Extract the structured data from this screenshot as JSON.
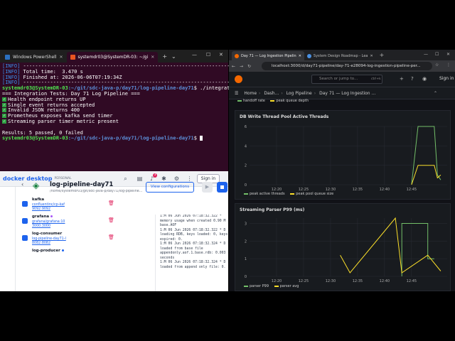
{
  "terminal": {
    "tabs": [
      "Windows PowerShell",
      "systemdr03@SystemDR-03: ~/gi"
    ],
    "output": [
      [
        "[INFO] ",
        "------------------------------------------------------------------------"
      ],
      [
        "[INFO] ",
        "Total time:  3.470 s"
      ],
      [
        "[INFO] ",
        "Finished at: 2026-06-06T07:19:34Z"
      ],
      [
        "[INFO] ",
        "------------------------------------------------------------------------"
      ]
    ],
    "prompt_user": "systemdr03@SystemDR-03",
    "prompt_path": ":~/git/sdc-java-p/day71/log-pipeline-day71",
    "command": "$ ./integration-tests/test-pipeline.sh",
    "header": "=== Integration Tests: Day 71 Log Pipeline ===",
    "checks": [
      "Health endpoint returns UP",
      "Single event returns accepted",
      "Invalid JSON returns 400",
      "Prometheus exposes kafka send timer",
      "Streaming parser timer metric present"
    ],
    "results": "Results: 5 passed, 0 failed",
    "prompt2_path": ":~/git/sdc-java-p/day71/log-pipeline-day71",
    "prompt2_suffix": "$ "
  },
  "docker": {
    "brand": "docker desktop",
    "plan": "PERSONAL",
    "notif_count": "3",
    "sign_in": "Sign in",
    "project_title": "log-pipeline-day71",
    "project_path": "/home/systemdr03/git/sdc-java-p/day71/log-pipeline...",
    "view_config": "View configurations",
    "containers": [
      {
        "name": "kafka",
        "image": "confluentinc/cp-kaf",
        "ports": "9092:9092"
      },
      {
        "name": "grafana",
        "image": "grafana/grafana:10",
        "ports": "3000:3000"
      },
      {
        "name": "log-consumer",
        "image": "log-pipeline-day71-l",
        "ports": "8082:8082"
      },
      {
        "name": "log-producer",
        "image": "",
        "ports": ""
      }
    ],
    "logs": [
      "1:M 06 Jun 2026 07:18:32.322 *",
      "memory usage when created 0.90 M",
      "base.AOF",
      "1:M 06 Jun 2026 07:18:32.322 * D",
      "loading RDB, keys loaded: 0, keys",
      "expired: 0.",
      "1:M 06 Jun 2026 07:18:32.324 * D",
      "loaded from base file",
      "appendonly.aof.1.base.rdb: 0.003",
      "seconds",
      "1:M 06 Jun 2026 07:18:32.324 * D",
      "loaded from append only file: 0."
    ]
  },
  "browser": {
    "tabs": [
      "Day 71 — Log Ingestion Pipelin",
      "System Design Roadmap - Lea"
    ],
    "url": "localhost:3000/d/day71-pipeline/day-71-e28094-log-ingestion-pipeline-per...",
    "search_placeholder": "Search or jump to...",
    "search_shortcut": "ctrl+k",
    "sign_in": "Sign in",
    "breadcrumb": [
      "Home",
      "Dash...",
      "Log Pipeline",
      "Day 71 — Log Ingestion ..."
    ],
    "colors": {
      "green": "#73bf69",
      "yellow": "#fade2a",
      "orange": "#f46800"
    }
  },
  "chart_data": [
    {
      "type": "line",
      "title": "",
      "legend": [
        "handoff rate",
        "peak queue depth"
      ],
      "series": []
    },
    {
      "type": "line",
      "title": "DB Write Thread Pool Active Threads",
      "x": [
        "12:20",
        "12:25",
        "12:30",
        "12:35",
        "12:40",
        "12:45"
      ],
      "ylim": [
        0,
        6
      ],
      "yticks": [
        "0",
        "2",
        "4",
        "6"
      ],
      "series": [
        {
          "name": "peak active threads",
          "color": "#73bf69",
          "points": [
            [
              12.75,
              0
            ],
            [
              12.77,
              6
            ],
            [
              12.82,
              6
            ],
            [
              12.83,
              1
            ],
            [
              12.84,
              0.5
            ]
          ]
        },
        {
          "name": "peak pool queue size",
          "color": "#fade2a",
          "points": [
            [
              12.75,
              0
            ],
            [
              12.77,
              2
            ],
            [
              12.82,
              2
            ],
            [
              12.83,
              0.7
            ],
            [
              12.84,
              1
            ]
          ]
        }
      ]
    },
    {
      "type": "line",
      "title": "Streaming Parser P99 (ms)",
      "x": [
        "12:20",
        "12:25",
        "12:30",
        "12:35",
        "12:40",
        "12:45"
      ],
      "ylim": [
        0,
        3.3
      ],
      "yticks": [
        "0",
        "1",
        "2",
        "3"
      ],
      "series": [
        {
          "name": "parser P99",
          "color": "#73bf69",
          "points": [
            [
              12.72,
              0
            ],
            [
              12.72,
              3
            ],
            [
              12.8,
              3
            ],
            [
              12.8,
              1
            ],
            [
              12.82,
              1
            ]
          ]
        },
        {
          "name": "parser avg",
          "color": "#fade2a",
          "points": [
            [
              12.53,
              1.2
            ],
            [
              12.56,
              0.2
            ],
            [
              12.7,
              3.3
            ],
            [
              12.72,
              0.2
            ],
            [
              12.8,
              1.2
            ],
            [
              12.84,
              0.3
            ]
          ]
        }
      ]
    }
  ]
}
